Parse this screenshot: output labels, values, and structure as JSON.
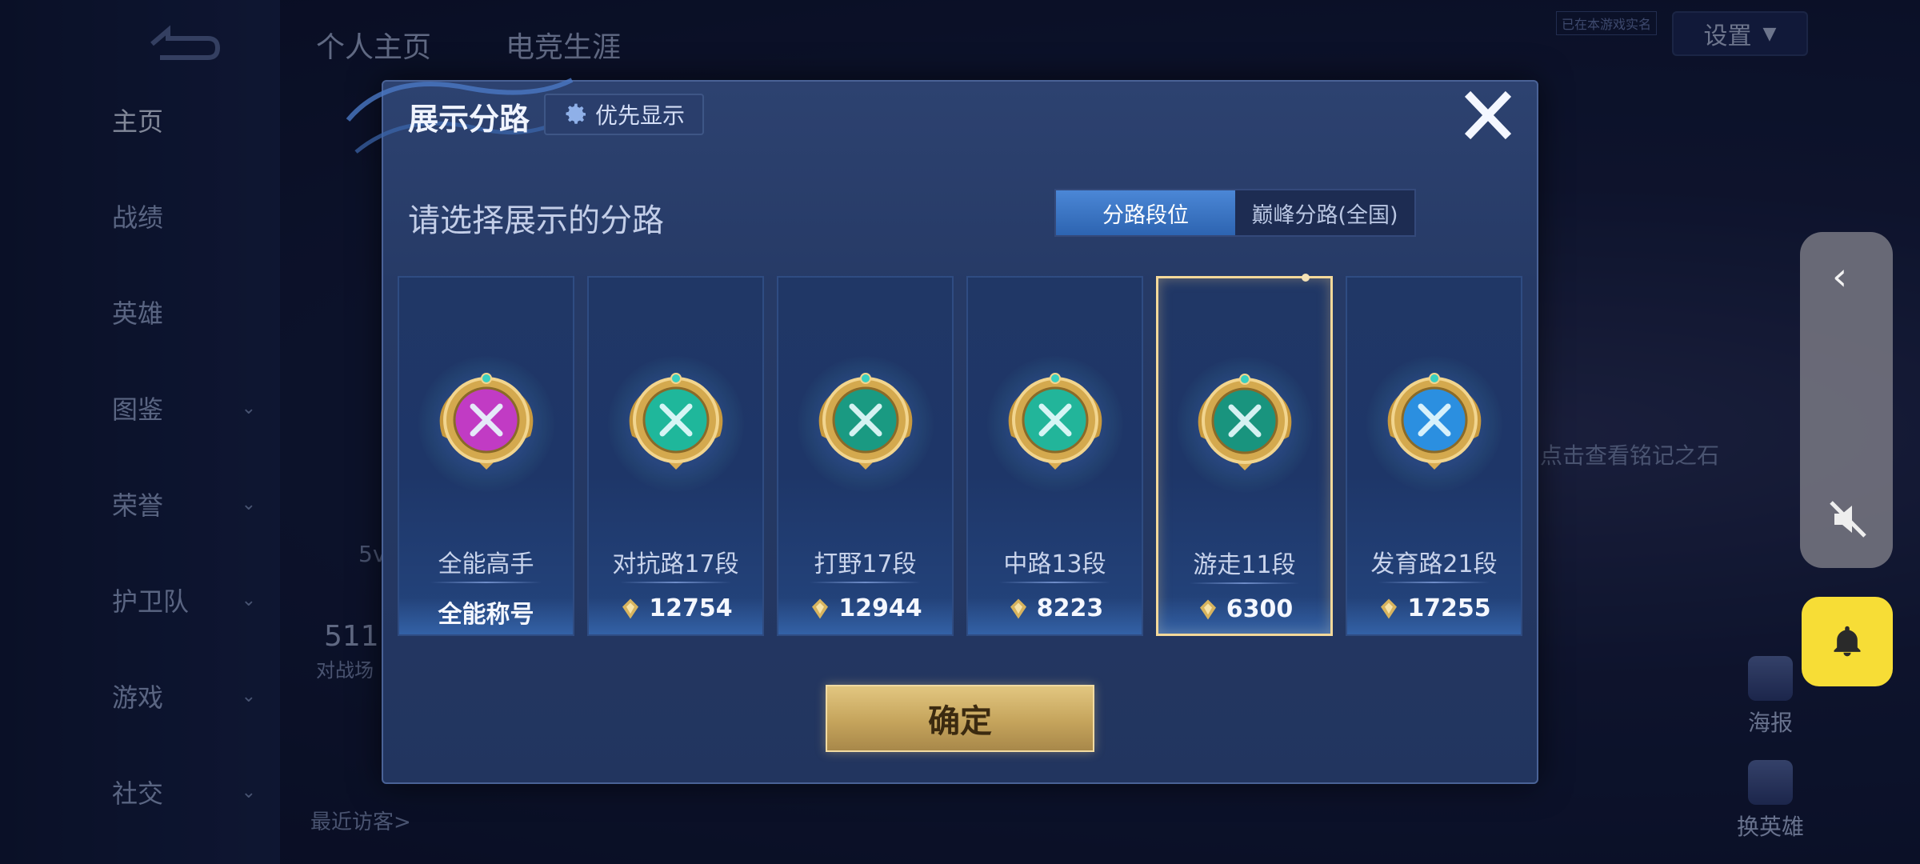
{
  "background": {
    "top_tabs": [
      "个人主页",
      "电竞生涯"
    ],
    "nav_items": [
      {
        "label": "主页",
        "chevron": false
      },
      {
        "label": "战绩",
        "chevron": false
      },
      {
        "label": "英雄",
        "chevron": false
      },
      {
        "label": "图鉴",
        "chevron": true
      },
      {
        "label": "荣誉",
        "chevron": true
      },
      {
        "label": "护卫队",
        "chevron": true
      },
      {
        "label": "游戏",
        "chevron": true
      },
      {
        "label": "社交",
        "chevron": true
      }
    ],
    "settings_label": "设置",
    "corner_label": "已在本游戏实名",
    "stat_number": "511",
    "stat_caption": "对战场",
    "fivev": "5v",
    "recent_visitors": "最近访客>",
    "inscription_hint": "点击查看铭记之石",
    "poster_label": "海报",
    "swap_hero_label": "换英雄"
  },
  "modal": {
    "title": "展示分路",
    "priority_button": "优先显示",
    "subtitle": "请选择展示的分路",
    "toggle": {
      "active": "分路段位",
      "inactive": "巅峰分路(全国)"
    },
    "cards": [
      {
        "label": "全能高手",
        "value": "全能称号",
        "has_points_icon": false,
        "emblem_color": "#c13bc4",
        "selected": false
      },
      {
        "label": "对抗路17段",
        "value": "12754",
        "has_points_icon": true,
        "emblem_color": "#1fb79b",
        "selected": false
      },
      {
        "label": "打野17段",
        "value": "12944",
        "has_points_icon": true,
        "emblem_color": "#1a9a82",
        "selected": false
      },
      {
        "label": "中路13段",
        "value": "8223",
        "has_points_icon": true,
        "emblem_color": "#22b59a",
        "selected": false
      },
      {
        "label": "游走11段",
        "value": "6300",
        "has_points_icon": true,
        "emblem_color": "#19947e",
        "selected": true
      },
      {
        "label": "发育路21段",
        "value": "17255",
        "has_points_icon": true,
        "emblem_color": "#2b8fe0",
        "selected": false
      }
    ],
    "confirm_label": "确定"
  },
  "colors": {
    "accent_gold": "#e2c680",
    "toggle_active": "#3f7bcf",
    "bell_button": "#f7dd36"
  }
}
